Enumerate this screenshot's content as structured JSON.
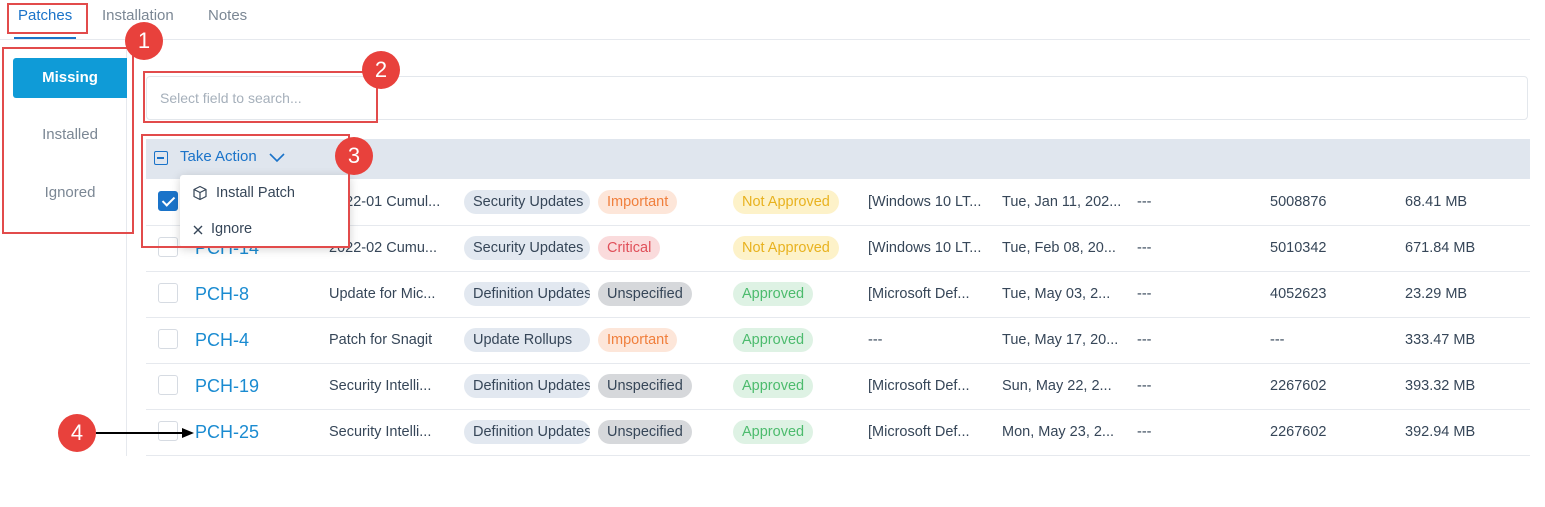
{
  "tabs": [
    {
      "label": "Patches"
    },
    {
      "label": "Installation"
    },
    {
      "label": "Notes"
    }
  ],
  "filters": [
    {
      "label": "Missing"
    },
    {
      "label": "Installed"
    },
    {
      "label": "Ignored"
    }
  ],
  "search": {
    "placeholder": "Select field to search..."
  },
  "take_action": {
    "label": "Take Action"
  },
  "menu": {
    "items": [
      {
        "label": "Install Patch"
      },
      {
        "label": "Ignore"
      }
    ]
  },
  "rows": [
    {
      "id": "",
      "name": "2022-01 Cumul...",
      "category": "Security Updates",
      "severity": "Important",
      "approval": "Not Approved",
      "platform": "[Windows 10 LT...",
      "date": "Tue, Jan 11, 202...",
      "bulletin": "---",
      "kb": "5008876",
      "size": "68.41 MB",
      "checked": true
    },
    {
      "id": "PCH-14",
      "name": "2022-02 Cumu...",
      "category": "Security Updates",
      "severity": "Critical",
      "approval": "Not Approved",
      "platform": "[Windows 10 LT...",
      "date": "Tue, Feb 08, 20...",
      "bulletin": "---",
      "kb": "5010342",
      "size": "671.84 MB",
      "checked": false
    },
    {
      "id": "PCH-8",
      "name": "Update for Mic...",
      "category": "Definition Updates",
      "severity": "Unspecified",
      "approval": "Approved",
      "platform": "[Microsoft Def...",
      "date": "Tue, May 03, 2...",
      "bulletin": "---",
      "kb": "4052623",
      "size": "23.29 MB",
      "checked": false
    },
    {
      "id": "PCH-4",
      "name": "Patch for Snagit",
      "category": "Update Rollups",
      "severity": "Important",
      "approval": "Approved",
      "platform": "---",
      "date": "Tue, May 17, 20...",
      "bulletin": "---",
      "kb": "---",
      "size": "333.47 MB",
      "checked": false
    },
    {
      "id": "PCH-19",
      "name": "Security Intelli...",
      "category": "Definition Updates",
      "severity": "Unspecified",
      "approval": "Approved",
      "platform": "[Microsoft Def...",
      "date": "Sun, May 22, 2...",
      "bulletin": "---",
      "kb": "2267602",
      "size": "393.32 MB",
      "checked": false
    },
    {
      "id": "PCH-25",
      "name": "Security Intelli...",
      "category": "Definition Updates",
      "severity": "Unspecified",
      "approval": "Approved",
      "platform": "[Microsoft Def...",
      "date": "Mon, May 23, 2...",
      "bulletin": "---",
      "kb": "2267602",
      "size": "392.94 MB",
      "checked": false
    }
  ],
  "annotations": [
    {
      "label": "1"
    },
    {
      "label": "2"
    },
    {
      "label": "3"
    },
    {
      "label": "4"
    }
  ],
  "colors": {
    "accent": "#1a73c9",
    "active_filter": "#0f9bd7",
    "annotation_red": "#e8413c"
  }
}
